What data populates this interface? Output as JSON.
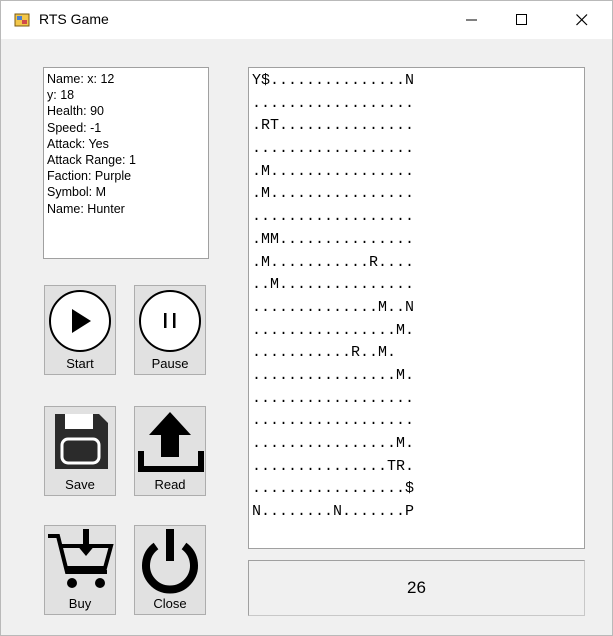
{
  "window": {
    "title": "RTS Game"
  },
  "info": {
    "lines": [
      "Name: x: 12",
      "y: 18",
      "Health: 90",
      "Speed: -1",
      "Attack: Yes",
      "Attack Range: 1",
      "Faction: Purple",
      "Symbol: M",
      "Name: Hunter"
    ]
  },
  "buttons": {
    "start": "Start",
    "pause": "Pause",
    "save": "Save",
    "read": "Read",
    "buy": "Buy",
    "close": "Close"
  },
  "map": {
    "rows": [
      "Y$...............N",
      "..................",
      ".RT...............",
      "..................",
      ".M................",
      ".M................",
      "..................",
      ".MM...............",
      ".M...........R....",
      "..M...............",
      "..............M..N",
      "................M.",
      "...........R..M.",
      "................M.",
      "..................",
      "..................",
      "................M.",
      "...............TR.",
      ".................$",
      "N........N.......P"
    ]
  },
  "counter": {
    "value": "26"
  }
}
